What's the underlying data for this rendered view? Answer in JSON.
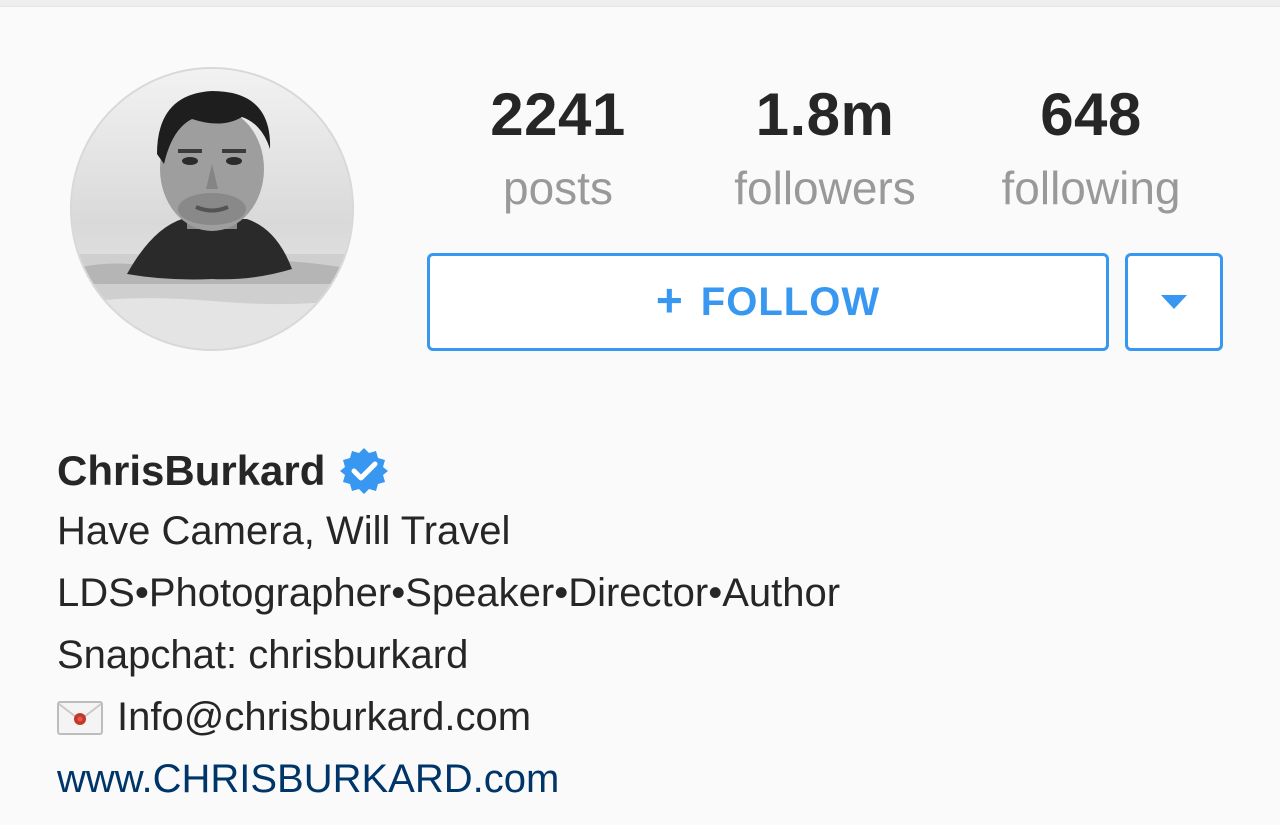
{
  "profile": {
    "avatar_icon": "profile-photo",
    "username": "ChrisBurkard",
    "verified_icon": "verified-badge-icon"
  },
  "stats": {
    "posts": {
      "value": "2241",
      "label": "posts"
    },
    "followers": {
      "value": "1.8m",
      "label": "followers"
    },
    "following": {
      "value": "648",
      "label": "following"
    }
  },
  "actions": {
    "follow_icon": "+",
    "follow_label": "FOLLOW",
    "dropdown_icon": "caret-down-icon"
  },
  "bio": {
    "line1": "Have Camera, Will Travel",
    "line2": "LDS•Photographer•Speaker•Director•Author",
    "line3": "Snapchat: chrisburkard",
    "email_icon": "envelope-icon",
    "email": "Info@chrisburkard.com",
    "website": "www.CHRISBURKARD.com"
  },
  "colors": {
    "accent": "#3897f0",
    "link": "#003569",
    "muted": "#999999",
    "text": "#262626"
  }
}
